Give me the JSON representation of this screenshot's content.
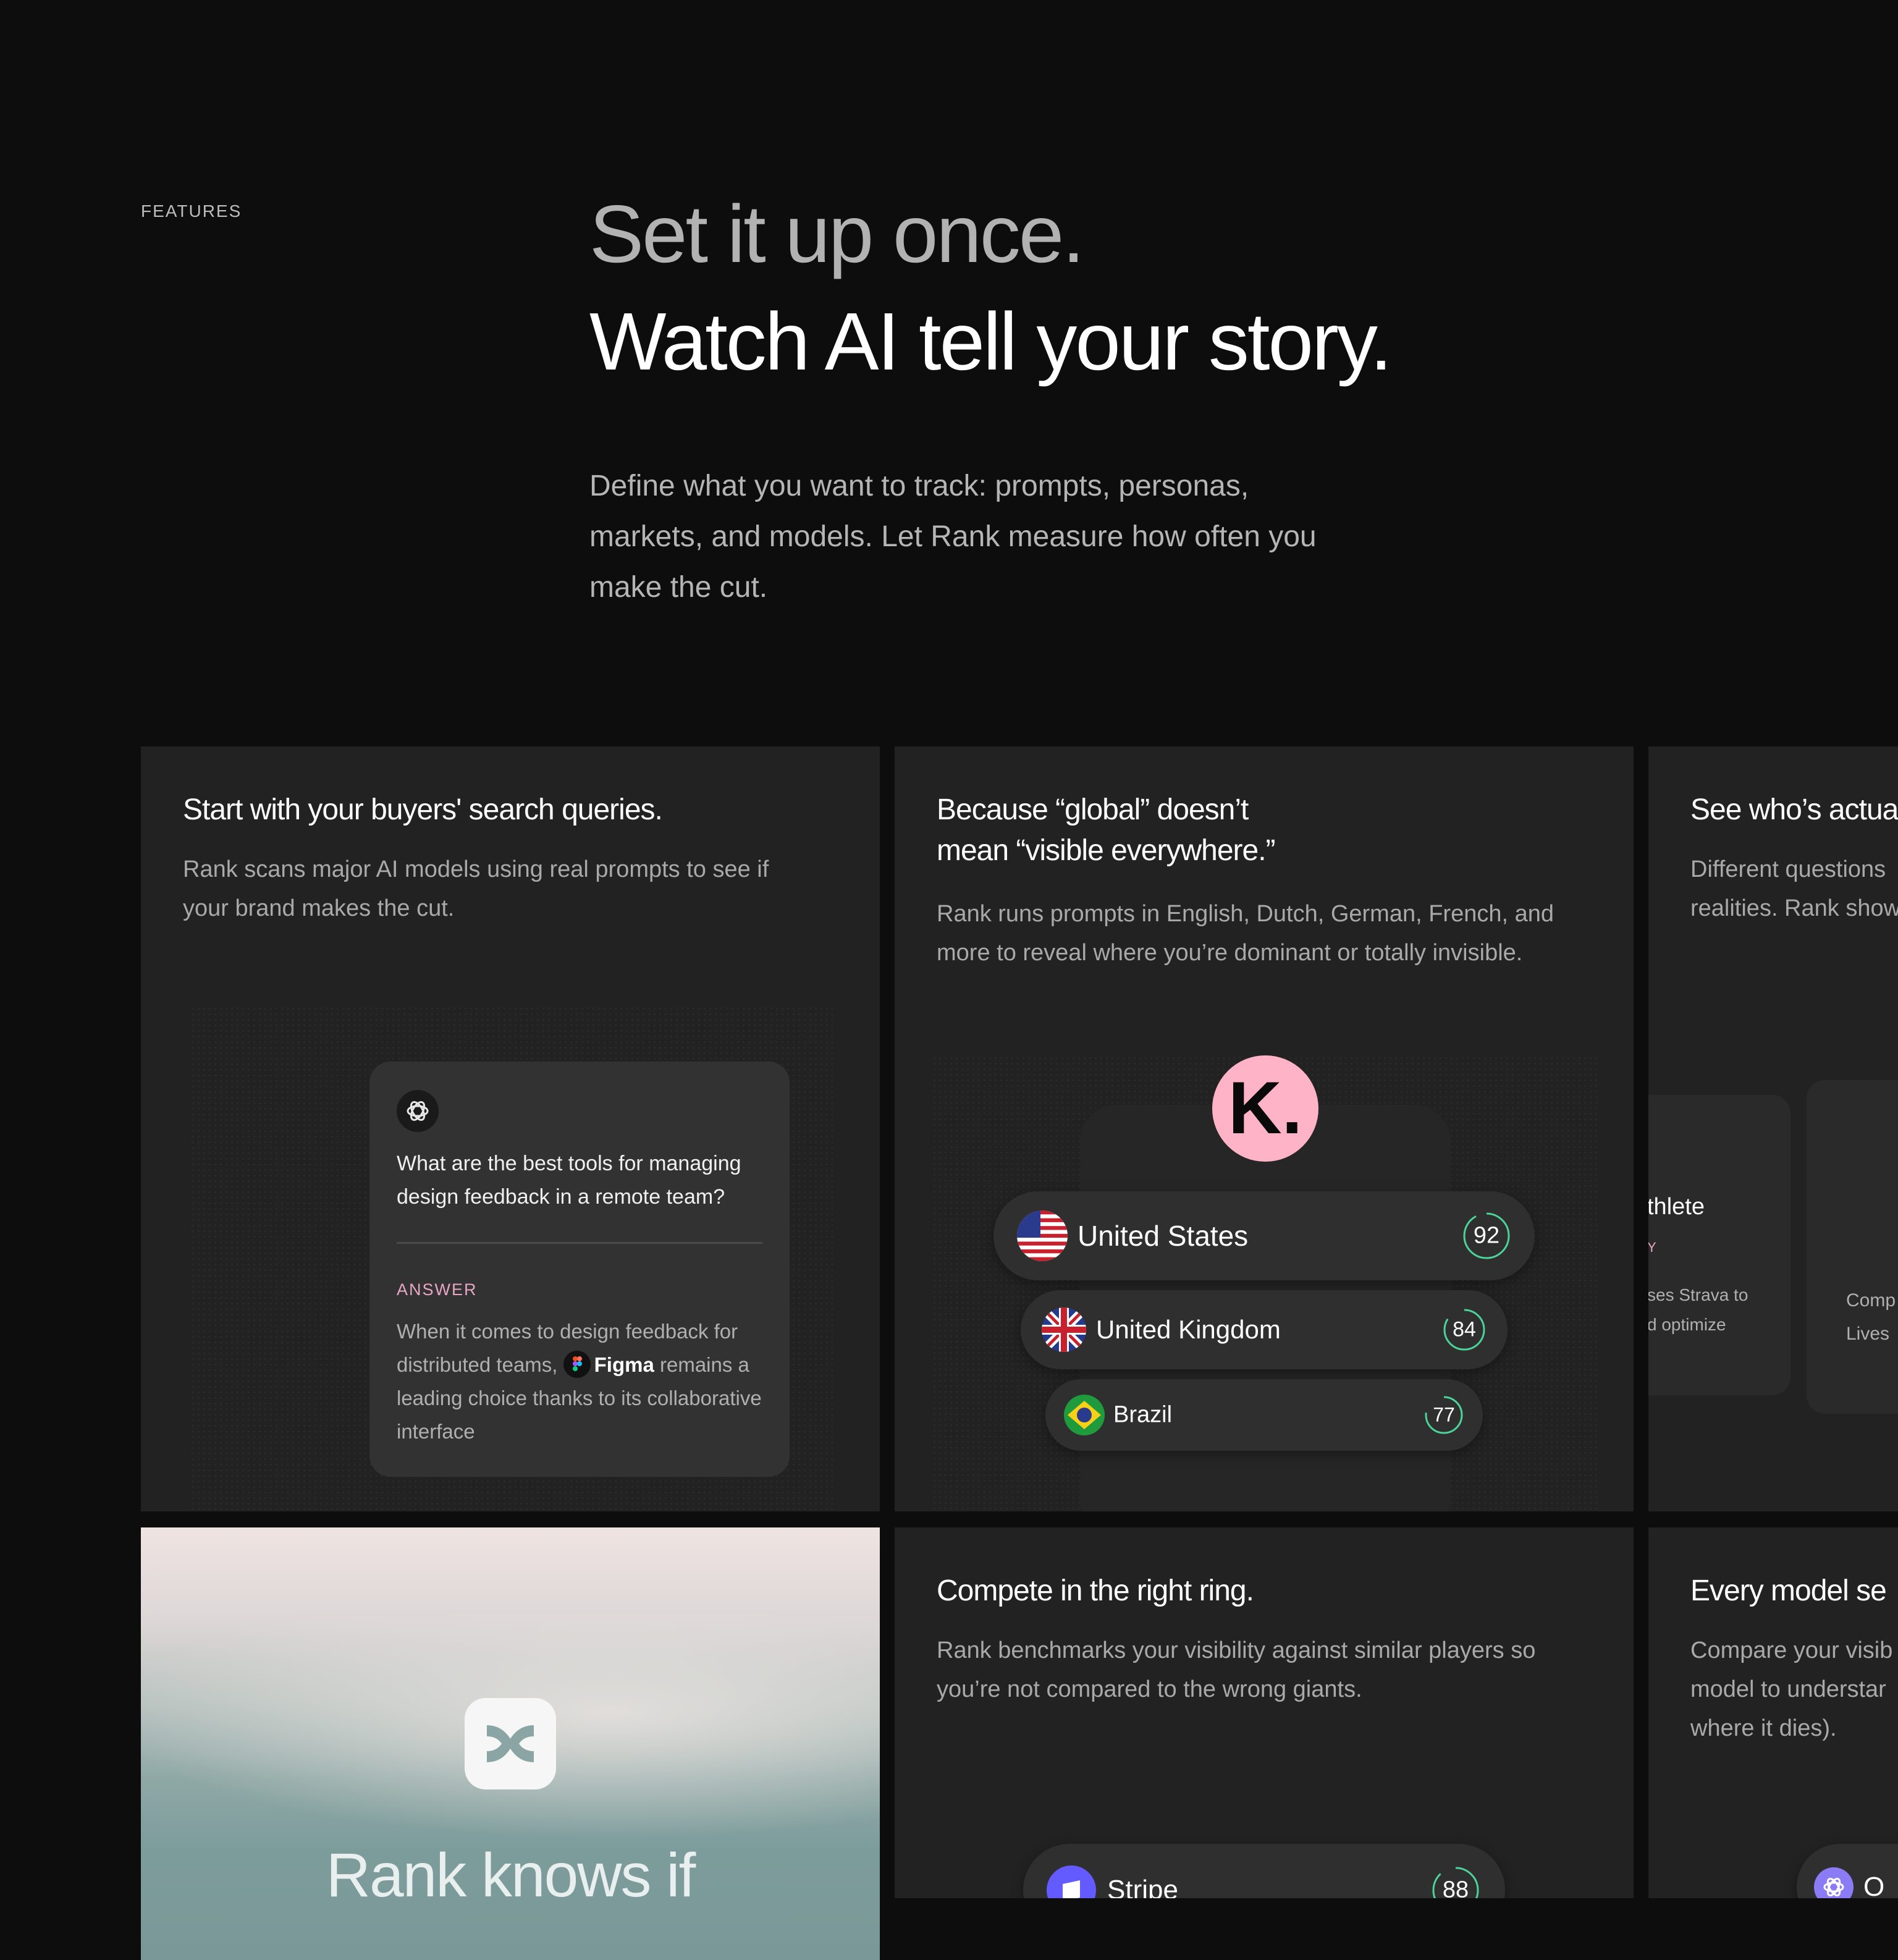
{
  "header": {
    "eyebrow": "FEATURES",
    "headline_line1": "Set it up once.",
    "headline_line2": "Watch AI tell your story.",
    "lede": "Define what you want to track: prompts, personas, markets, and models. Let Rank measure how often you make the cut."
  },
  "cards": {
    "queries": {
      "title": "Start with your buyers' search queries.",
      "description": "Rank scans major AI models using real prompts to see if your brand makes the cut.",
      "chat": {
        "question": "What are the best tools for managing design feedback in a remote team?",
        "answer_label": "ANSWER",
        "answer_before": "When it comes to design feedback for distributed teams,",
        "answer_brand": "Figma",
        "answer_after": "remains a leading choice thanks to its collaborative interface"
      }
    },
    "global": {
      "title_line1": "Because “global” doesn’t",
      "title_line2": "mean “visible everywhere.”",
      "description": "Rank runs prompts in English, Dutch, German, French, and more to reveal where you’re dominant or totally invisible.",
      "brand_mark": "K.",
      "countries": [
        {
          "name": "United States",
          "score": "92",
          "score_value": 92
        },
        {
          "name": "United Kingdom",
          "score": "84",
          "score_value": 84
        },
        {
          "name": "Brazil",
          "score": "77",
          "score_value": 77
        }
      ]
    },
    "personas": {
      "title": "See who’s actua",
      "description_line1": "Different questions",
      "description_line2": "realities. Rank show",
      "fragment_title": "thlete",
      "fragment_tag": "Y",
      "fragment_text_line1": "ses Strava to",
      "fragment_text_line2": "d optimize",
      "fragment2_line1": "Comp",
      "fragment2_line2": "Lives"
    },
    "image": {
      "headline": "Rank knows if"
    },
    "ring": {
      "title": "Compete in the right ring.",
      "description": "Rank benchmarks your visibility against similar players so you’re not compared to the wrong giants.",
      "competitor": {
        "name": "Stripe",
        "score": "88",
        "score_value": 88
      }
    },
    "models": {
      "title": "Every model se",
      "description_line1": "Compare your visib",
      "description_line2": "model to understar",
      "description_line3": "where it dies).",
      "model_pill_label": "O"
    }
  },
  "colors": {
    "background": "#0d0d0e",
    "card": "#222223",
    "accent_pink": "#e7a6c2",
    "score_green": "#4cd39a",
    "klarna_pink": "#ffb3c7",
    "stripe_purple": "#635bff"
  }
}
